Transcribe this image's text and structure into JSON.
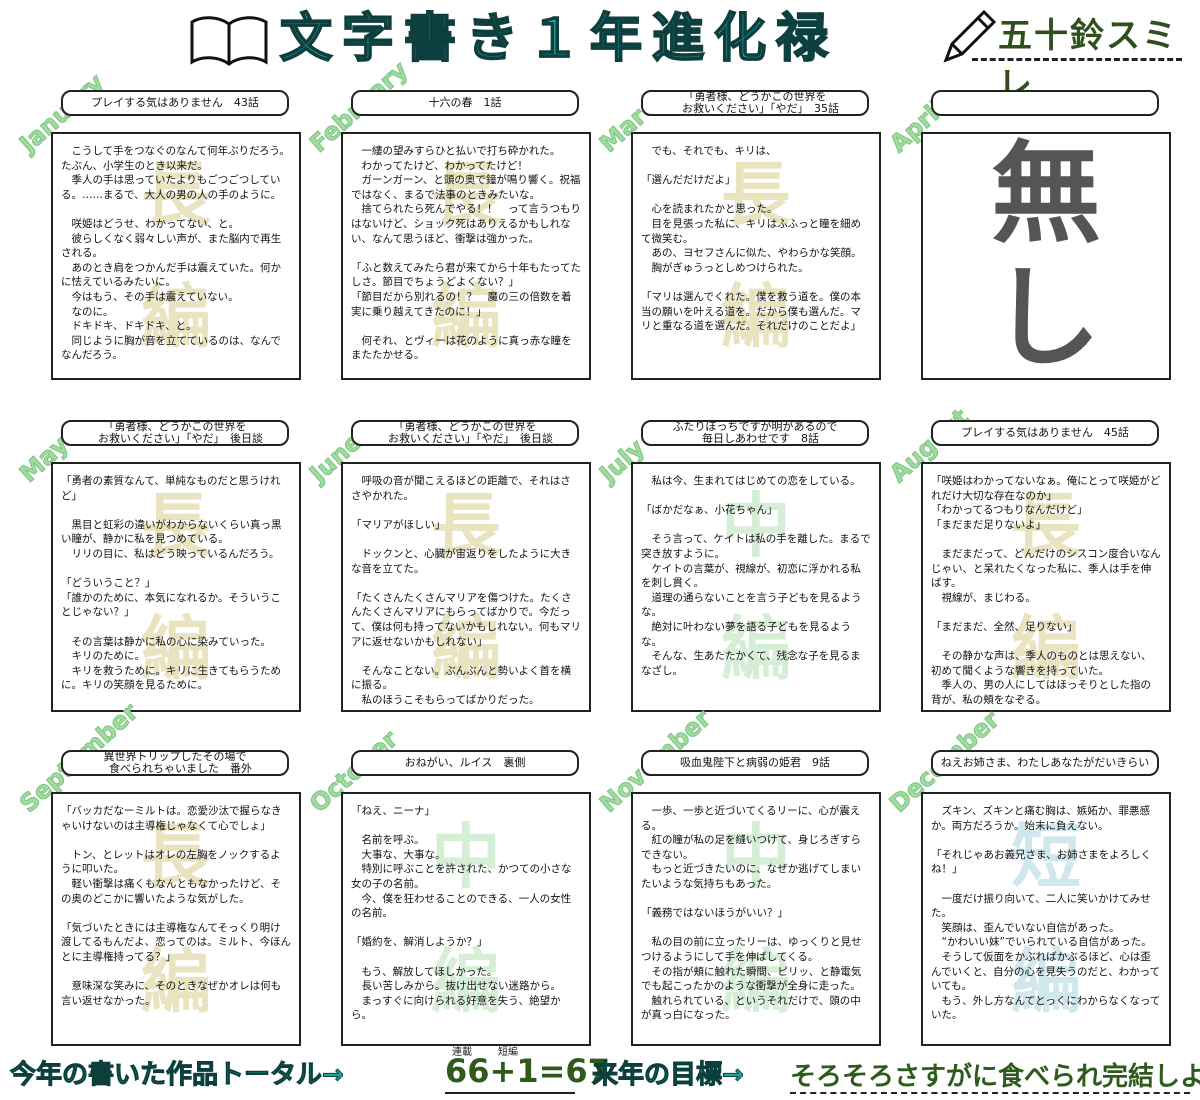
{
  "header": {
    "title": "文字書き１年進化禄",
    "author": "五十鈴スミレ",
    "book_icon": "open-book-icon",
    "pencil_icon": "pencil-icon"
  },
  "months": [
    {
      "name": "January",
      "title": "プレイする気はありません　43話",
      "watermark": [
        "長",
        "編"
      ],
      "wm_type": "long",
      "text": "　こうして手をつなぐのなんて何年ぶりだろう。たぶん、小学生のとき以来だ。\n　季人の手は思っていたよりもごつごつしている。……まるで、大人の男の人の手のように。\n\n　咲姫はどうせ、わかってない、と。\n　彼らしくなく弱々しい声が、また脳内で再生される。\n　あのとき肩をつかんだ手は震えていた。何かに怯えているみたいに。\n　今はもう、その手は震えていない。\n　なのに。\n　ドキドキ、ドキドキ、と。\n　同じように胸が音を立てているのは、なんでなんだろう。"
    },
    {
      "name": "February",
      "title": "十六の春　1話",
      "watermark": [
        "長",
        "編"
      ],
      "wm_type": "long",
      "text": "　一縷の望みすらひと払いで打ち砕かれた。\n　わかってたけど、わかってたけど！\n　ガーンガーン、と頭の奥で鐘が鳴り響く。祝福ではなく、まるで法事のときみたいな。\n　捨てられたら死んでやる！！　って言うつもりはないけど、ショック死はありえるかもしれない、なんて思うほど、衝撃は強かった。\n\n「ふと数えてみたら君が来てから十年もたってたしさ。節目でちょうどよくない？」\n「節目だから別れるの！？　魔の三の倍数を着実に乗り越えてきたのに！」\n\n　何それ、とヴィーは花のように真っ赤な瞳をまたたかせる。"
    },
    {
      "name": "March",
      "title": "「勇者様、どうかこの世界を\n　お救いください」「やだ」　35話",
      "watermark": [
        "長",
        "編"
      ],
      "wm_type": "long",
      "text": "　でも、それでも、キリは、\n\n「選んだだけだよ」\n\n　心を読まれたかと思った。\n　目を見張った私に、キリはふふっと瞳を細めて微笑む。\n　あの、ヨセフさんに似た、やわらかな笑顔。\n　胸がぎゅうっとしめつけられた。\n\n「マリは選んでくれた。僕を救う道を。僕の本当の願いを叶える道を。だから僕も選んだ。マリと重なる道を選んだ。それだけのことだよ」"
    },
    {
      "name": "April",
      "title": "",
      "watermark": [],
      "wm_type": "none",
      "none": [
        "無",
        "し"
      ],
      "text": ""
    },
    {
      "name": "May",
      "title": "「勇者様、どうかこの世界を\n　お救いください」「やだ」　後日談",
      "watermark": [
        "長",
        "編"
      ],
      "wm_type": "long",
      "text": "「勇者の素質なんて、単純なものだと思うけれど」\n\n　黒目と虹彩の違いがわからないくらい真っ黒い瞳が、静かに私を見つめている。\n　リリの目に、私はどう映っているんだろう。\n\n「どういうこと？」\n「誰かのために、本気になれるか。そういうことじゃない？」\n\n　その言葉は静かに私の心に染みていった。\n　キリのために。\n　キリを救うために。キリに生きてもらうために。キリの笑顔を見るために。"
    },
    {
      "name": "June",
      "title": "「勇者様、どうかこの世界を\n　お救いください」「やだ」　後日談",
      "watermark": [
        "長",
        "編"
      ],
      "wm_type": "long",
      "text": "　呼吸の音が聞こえるほどの距離で、それはささやかれた。\n\n「マリアがほしい」\n\n　ドックンと、心臓が宙返りをしたように大きな音を立てた。\n\n「たくさんたくさんマリアを傷つけた。たくさんたくさんマリアにもらってばかりで。今だって、僕は何も持ってないかもしれない。何もマリアに返せないかもしれない」\n\n　そんなことない。ぶんぶんと勢いよく首を横に振る。\n　私のほうこそもらってばかりだった。"
    },
    {
      "name": "July",
      "title": "ふたりぼっちですが明があるので\n　毎日しあわせです　8話",
      "watermark": [
        "中",
        "編"
      ],
      "wm_type": "mid",
      "text": "　私は今、生まれてはじめての恋をしている。\n\n「ばかだなぁ、小花ちゃん」\n\n　そう言って、ケイトは私の手を離した。まるで突き放すように。\n　ケイトの言葉が、視線が、初恋に浮かれる私を刺し貫く。\n　道理の通らないことを言う子どもを見るような。\n　絶対に叶わない夢を語る子どもを見るような。\n　そんな、生あたたかくて、残念な子を見るまなざし。"
    },
    {
      "name": "August",
      "title": "プレイする気はありません　45話",
      "watermark": [
        "長",
        "編"
      ],
      "wm_type": "long",
      "text": "「咲姫はわかってないなぁ。俺にとって咲姫がどれだけ大切な存在なのか」\n「わかってるつもりなんだけど」\n「まだまだ足りないよ」\n\n　まだまだって、どんだけのシスコン度合いなんじゃい、と呆れたくなった私に、季人は手を伸ばす。\n　視線が、まじわる。\n\n「まだまだ、全然、足りない」\n\n　その静かな声は、季人のものとは思えない、初めて聞くような響きを持っていた。\n　季人の、男の人にしてはほっそりとした指の背が、私の頬をなぞる。"
    },
    {
      "name": "September",
      "title": "異世界トリップしたその場で\n　食べられちゃいました　番外",
      "watermark": [
        "長",
        "編"
      ],
      "wm_type": "long",
      "text": "「バッカだなーミルトは。恋愛沙汰で握らなきゃいけないのは主導権じゃなくて心でしょ」\n\n　トン、とレットはオレの左胸をノックするように叩いた。\n　軽い衝撃は痛くもなんともなかったけど、その奥のどこかに響いたような気がした。\n\n「気づいたときには主導権なんてそっくり明け渡してるもんだよ、恋ってのは。ミルト、今ほんとに主導権持ってる？」\n\n　意味深な笑みに、そのときなぜかオレは何も言い返せなかった。"
    },
    {
      "name": "October",
      "title": "おねがい、ルイス　裏側",
      "watermark": [
        "中",
        "編"
      ],
      "wm_type": "mid",
      "text": "「ねえ、ニーナ」\n\n　名前を呼ぶ。\n　大事な、大事な。\n　特別に呼ぶことを許された、かつての小さな女の子の名前。\n　今、僕を狂わせることのできる、一人の女性の名前。\n\n「婚約を、解消しようか？」\n\n　もう、解放してほしかった。\n　長い苦しみから。抜け出せない迷路から。\n　まっすぐに向けられる好意を失う、絶望から。"
    },
    {
      "name": "November",
      "title": "吸血鬼陛下と病弱の姫君　9話",
      "watermark": [
        "中",
        "編"
      ],
      "wm_type": "mid",
      "text": "　一歩、一歩と近づいてくるリーに、心が震える。\n　紅の瞳が私の足を縫いつけて、身じろぎすらできない。\n　もっと近づきたいのに、なぜか逃げてしまいたいような気持ちもあった。\n\n「義務ではないほうがいい？」\n\n　私の目の前に立ったリーは、ゆっくりと見せつけるようにして手を伸ばしてくる。\n　その指が頬に触れた瞬間、ピリッ、と静電気でも起こったかのような衝撃が全身に走った。\n　触れられている、というそれだけで、頭の中が真っ白になった。"
    },
    {
      "name": "December",
      "title": "ねえお姉さま、わたしあなたがだいきらい",
      "watermark": [
        "短",
        "編"
      ],
      "wm_type": "short",
      "text": "　ズキン、ズキンと痛む胸は、嫉妬か、罪悪感か。両方だろうか。始末に負えない。\n\n「それじゃあお義兄さま、お姉さまをよろしくね！」\n\n　一度だけ振り向いて、二人に笑いかけてみせた。\n　笑顔は、歪んでいない自信があった。\n　“かわいい妹”でいられている自信があった。\n　そうして仮面をかぶればかぶるほど、心は歪んでいくと、自分の心を見失うのだと、わかっていても。\n　もう、外し方なんてとっくにわからなくなっていた。"
    }
  ],
  "footer": {
    "total_label": "今年の書いた作品トータル→",
    "total_value": "66+1=67",
    "serial_label": "連載",
    "short_label": "短編",
    "goal_label": "来年の目標→",
    "goal_value": "そろそろさすがに食べられ完結しよ?"
  }
}
